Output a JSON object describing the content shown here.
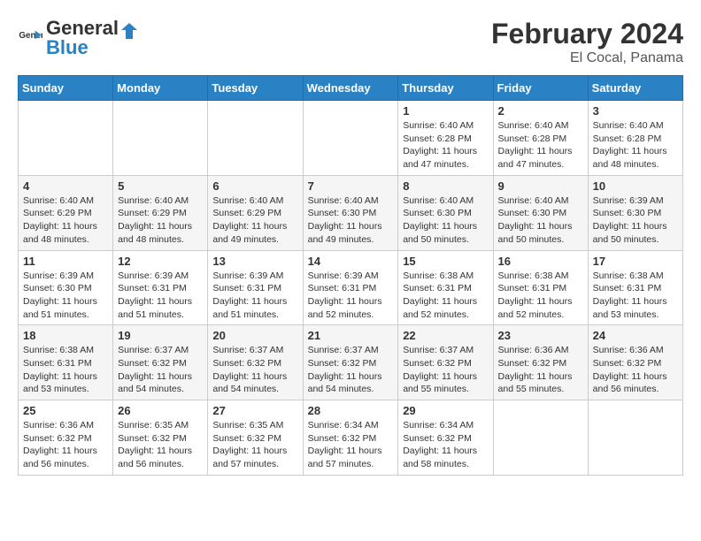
{
  "header": {
    "logo_general": "General",
    "logo_blue": "Blue",
    "title": "February 2024",
    "subtitle": "El Cocal, Panama"
  },
  "weekdays": [
    "Sunday",
    "Monday",
    "Tuesday",
    "Wednesday",
    "Thursday",
    "Friday",
    "Saturday"
  ],
  "weeks": [
    [
      {
        "day": "",
        "info": ""
      },
      {
        "day": "",
        "info": ""
      },
      {
        "day": "",
        "info": ""
      },
      {
        "day": "",
        "info": ""
      },
      {
        "day": "1",
        "info": "Sunrise: 6:40 AM\nSunset: 6:28 PM\nDaylight: 11 hours and 47 minutes."
      },
      {
        "day": "2",
        "info": "Sunrise: 6:40 AM\nSunset: 6:28 PM\nDaylight: 11 hours and 47 minutes."
      },
      {
        "day": "3",
        "info": "Sunrise: 6:40 AM\nSunset: 6:28 PM\nDaylight: 11 hours and 48 minutes."
      }
    ],
    [
      {
        "day": "4",
        "info": "Sunrise: 6:40 AM\nSunset: 6:29 PM\nDaylight: 11 hours and 48 minutes."
      },
      {
        "day": "5",
        "info": "Sunrise: 6:40 AM\nSunset: 6:29 PM\nDaylight: 11 hours and 48 minutes."
      },
      {
        "day": "6",
        "info": "Sunrise: 6:40 AM\nSunset: 6:29 PM\nDaylight: 11 hours and 49 minutes."
      },
      {
        "day": "7",
        "info": "Sunrise: 6:40 AM\nSunset: 6:30 PM\nDaylight: 11 hours and 49 minutes."
      },
      {
        "day": "8",
        "info": "Sunrise: 6:40 AM\nSunset: 6:30 PM\nDaylight: 11 hours and 50 minutes."
      },
      {
        "day": "9",
        "info": "Sunrise: 6:40 AM\nSunset: 6:30 PM\nDaylight: 11 hours and 50 minutes."
      },
      {
        "day": "10",
        "info": "Sunrise: 6:39 AM\nSunset: 6:30 PM\nDaylight: 11 hours and 50 minutes."
      }
    ],
    [
      {
        "day": "11",
        "info": "Sunrise: 6:39 AM\nSunset: 6:30 PM\nDaylight: 11 hours and 51 minutes."
      },
      {
        "day": "12",
        "info": "Sunrise: 6:39 AM\nSunset: 6:31 PM\nDaylight: 11 hours and 51 minutes."
      },
      {
        "day": "13",
        "info": "Sunrise: 6:39 AM\nSunset: 6:31 PM\nDaylight: 11 hours and 51 minutes."
      },
      {
        "day": "14",
        "info": "Sunrise: 6:39 AM\nSunset: 6:31 PM\nDaylight: 11 hours and 52 minutes."
      },
      {
        "day": "15",
        "info": "Sunrise: 6:38 AM\nSunset: 6:31 PM\nDaylight: 11 hours and 52 minutes."
      },
      {
        "day": "16",
        "info": "Sunrise: 6:38 AM\nSunset: 6:31 PM\nDaylight: 11 hours and 52 minutes."
      },
      {
        "day": "17",
        "info": "Sunrise: 6:38 AM\nSunset: 6:31 PM\nDaylight: 11 hours and 53 minutes."
      }
    ],
    [
      {
        "day": "18",
        "info": "Sunrise: 6:38 AM\nSunset: 6:31 PM\nDaylight: 11 hours and 53 minutes."
      },
      {
        "day": "19",
        "info": "Sunrise: 6:37 AM\nSunset: 6:32 PM\nDaylight: 11 hours and 54 minutes."
      },
      {
        "day": "20",
        "info": "Sunrise: 6:37 AM\nSunset: 6:32 PM\nDaylight: 11 hours and 54 minutes."
      },
      {
        "day": "21",
        "info": "Sunrise: 6:37 AM\nSunset: 6:32 PM\nDaylight: 11 hours and 54 minutes."
      },
      {
        "day": "22",
        "info": "Sunrise: 6:37 AM\nSunset: 6:32 PM\nDaylight: 11 hours and 55 minutes."
      },
      {
        "day": "23",
        "info": "Sunrise: 6:36 AM\nSunset: 6:32 PM\nDaylight: 11 hours and 55 minutes."
      },
      {
        "day": "24",
        "info": "Sunrise: 6:36 AM\nSunset: 6:32 PM\nDaylight: 11 hours and 56 minutes."
      }
    ],
    [
      {
        "day": "25",
        "info": "Sunrise: 6:36 AM\nSunset: 6:32 PM\nDaylight: 11 hours and 56 minutes."
      },
      {
        "day": "26",
        "info": "Sunrise: 6:35 AM\nSunset: 6:32 PM\nDaylight: 11 hours and 56 minutes."
      },
      {
        "day": "27",
        "info": "Sunrise: 6:35 AM\nSunset: 6:32 PM\nDaylight: 11 hours and 57 minutes."
      },
      {
        "day": "28",
        "info": "Sunrise: 6:34 AM\nSunset: 6:32 PM\nDaylight: 11 hours and 57 minutes."
      },
      {
        "day": "29",
        "info": "Sunrise: 6:34 AM\nSunset: 6:32 PM\nDaylight: 11 hours and 58 minutes."
      },
      {
        "day": "",
        "info": ""
      },
      {
        "day": "",
        "info": ""
      }
    ]
  ]
}
